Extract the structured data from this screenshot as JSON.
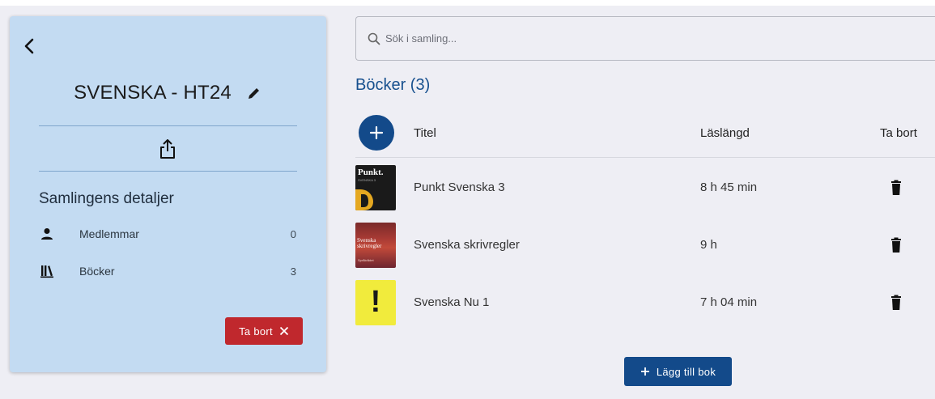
{
  "sidebar": {
    "title": "SVENSKA - HT24",
    "details_heading": "Samlingens detaljer",
    "details": [
      {
        "label": "Medlemmar",
        "count": "0",
        "icon": "person-icon"
      },
      {
        "label": "Böcker",
        "count": "3",
        "icon": "library-books-icon"
      }
    ],
    "delete_label": "Ta bort",
    "delete_color": "#c0282d",
    "background": "#c3dbf2"
  },
  "search": {
    "placeholder": "Sök i samling..."
  },
  "books": {
    "heading": "Böcker (3)",
    "columns": {
      "title": "Titel",
      "length": "Läslängd",
      "remove": "Ta bort"
    },
    "rows": [
      {
        "title": "Punkt Svenska 3",
        "length": "8 h 45 min",
        "cover_text": "Punkt.",
        "cover_sub": "SVENSKA 3"
      },
      {
        "title": "Svenska skrivregler",
        "length": "9 h",
        "cover_text": "Svenska skrivregler",
        "cover_sub": "Språkrådet"
      },
      {
        "title": "Svenska Nu 1",
        "length": "7 h 04 min",
        "cover_text": "!",
        "cover_sub": ""
      }
    ],
    "add_button_label": "Lägg till bok"
  },
  "colors": {
    "primary": "#134a8a",
    "heading": "#17508e",
    "danger": "#c0282d"
  }
}
